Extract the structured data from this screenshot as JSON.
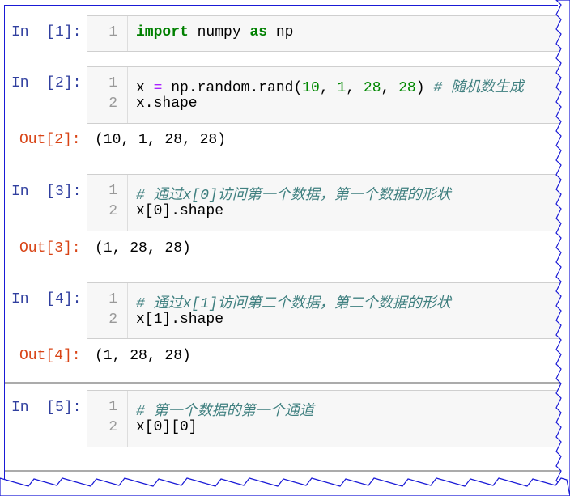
{
  "cells": [
    {
      "prompt": "In  [1]:",
      "lines": [
        {
          "n": "1"
        }
      ],
      "code": {
        "kw1": "import",
        "mod": " numpy ",
        "kw2": "as",
        "alias": " np"
      }
    },
    {
      "prompt": "In  [2]:",
      "lines": [
        {
          "n": "1"
        },
        {
          "n": "2"
        }
      ],
      "code": {
        "l1a": "x ",
        "eq": "=",
        "l1b": " np.random.rand(",
        "n1": "10",
        ",1": ", ",
        "n2": "1",
        "c2": ", ",
        "n3": "28",
        "c3": ", ",
        "n4": "28",
        "close": ") ",
        "comment": "# 随机数生成",
        "l2": "x.shape"
      },
      "out_prompt": "Out[2]:",
      "output": "(10, 1, 28, 28)"
    },
    {
      "prompt": "In  [3]:",
      "lines": [
        {
          "n": "1"
        },
        {
          "n": "2"
        }
      ],
      "code": {
        "comment": "# 通过x[0]访问第一个数据，第一个数据的形状",
        "l2": "x[0].shape"
      },
      "out_prompt": "Out[3]:",
      "output": "(1, 28, 28)"
    },
    {
      "prompt": "In  [4]:",
      "lines": [
        {
          "n": "1"
        },
        {
          "n": "2"
        }
      ],
      "code": {
        "comment": "# 通过x[1]访问第二个数据，第二个数据的形状",
        "l2": "x[1].shape"
      },
      "out_prompt": "Out[4]:",
      "output": "(1, 28, 28)"
    },
    {
      "prompt": "In  [5]:",
      "lines": [
        {
          "n": "1"
        },
        {
          "n": "2"
        }
      ],
      "code": {
        "comment": "# 第一个数据的第一个通道",
        "l2": "x[0][0]"
      }
    }
  ],
  "colors": {
    "prompt_in": "#303f9f",
    "prompt_out": "#d84315",
    "keyword": "#008000",
    "comment": "#408080",
    "frame_border": "#1a1ad6"
  }
}
